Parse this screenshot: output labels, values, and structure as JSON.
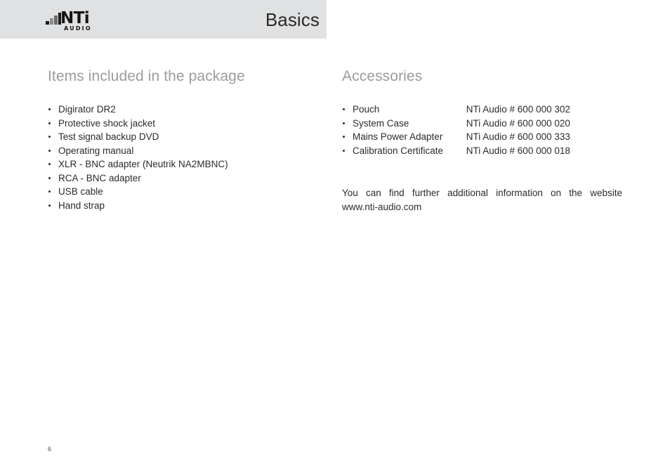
{
  "header": {
    "title": "Basics",
    "logo": {
      "wordmark": "NTi",
      "subtext": "AUDIO"
    },
    "band_color": "#e0e1e2"
  },
  "left_column": {
    "heading": "Items included in the package",
    "items": [
      "Digirator DR2",
      "Protective shock jacket",
      "Test signal backup DVD",
      "Operating manual",
      "XLR - BNC adapter (Neutrik NA2MBNC)",
      "RCA - BNC adapter",
      "USB cable",
      "Hand strap"
    ]
  },
  "right_column": {
    "heading": "Accessories",
    "accessories": [
      {
        "name": "Pouch",
        "code": "NTi Audio #  600 000 302"
      },
      {
        "name": "System Case",
        "code": "NTi Audio #  600 000 020"
      },
      {
        "name": "Mains Power Adapter",
        "code": "NTi Audio #  600 000 333"
      },
      {
        "name": "Calibration Certificate",
        "code": "NTi Audio #  600 000 018"
      }
    ],
    "note": {
      "line1": "You can find further additional information on the website",
      "line2": "www.nti-audio.com"
    }
  },
  "footer": {
    "page_number": "6"
  }
}
